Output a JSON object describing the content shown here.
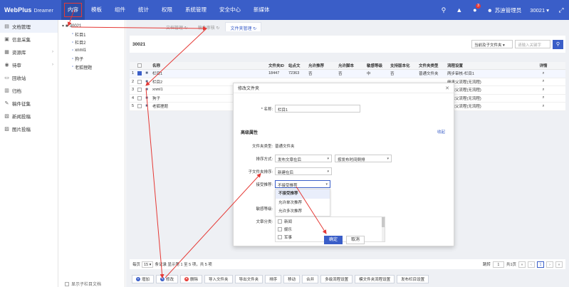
{
  "app": {
    "brand": "WebPlus",
    "sub": "Dreamer"
  },
  "nav": [
    "内容",
    "模板",
    "组件",
    "统计",
    "权限",
    "系统管理",
    "安全中心",
    "新媒体"
  ],
  "topbar": {
    "badge": "3",
    "user": "苏迪管理员",
    "site": "30021",
    "colors": {
      "bar": "#3a5ec8",
      "annotation": "#e53935"
    }
  },
  "sidebar": [
    {
      "label": "文档管理",
      "icon": "doc-icon"
    },
    {
      "label": "信息采集",
      "icon": "collect-icon"
    },
    {
      "label": "资源库",
      "icon": "library-icon",
      "arrow": true
    },
    {
      "label": "待审",
      "icon": "audit-icon",
      "arrow": true
    },
    {
      "label": "回收站",
      "icon": "trash-icon"
    },
    {
      "label": "归档",
      "icon": "archive-icon"
    },
    {
      "label": "稿件征集",
      "icon": "draft-icon"
    },
    {
      "label": "新闻投稿",
      "icon": "news-icon"
    },
    {
      "label": "图片投稿",
      "icon": "image-icon"
    }
  ],
  "tree": {
    "root": "30021",
    "children": [
      "栏目1",
      "栏目2",
      "xnml1",
      "狗子",
      "老狐狸题"
    ],
    "bottom": "显示子栏目文档"
  },
  "tabs": [
    "文档管理",
    "稿件审核",
    "文件夹管理"
  ],
  "toolbar": {
    "site_id": "30021",
    "filter": "当前及子文件夹",
    "search_placeholder": "请输入关键字"
  },
  "table": {
    "headers": [
      "",
      "",
      "",
      "名称",
      "文件夹ID",
      "站点文",
      "允许推荐",
      "允许脚本",
      "敏感等级",
      "支持版本化",
      "文件夹类型",
      "流程设置",
      "详情"
    ],
    "rows": [
      {
        "idx": "1",
        "checked": true,
        "name": "栏目1",
        "id": "18447",
        "site": "72363",
        "rec": "否",
        "script": "否",
        "sens": "中",
        "std": "否",
        "type": "普通文件夹",
        "flow": "两步审核-栏目1"
      },
      {
        "idx": "2",
        "checked": false,
        "name": "栏目2",
        "id": "",
        "site": "",
        "rec": "",
        "script": "",
        "sens": "",
        "std": "",
        "type": "",
        "flow": "继承父流程(无流程)"
      },
      {
        "idx": "3",
        "checked": false,
        "name": "xnml1",
        "id": "",
        "site": "",
        "rec": "",
        "script": "",
        "sens": "",
        "std": "",
        "type": "",
        "flow": "继承父流程(无流程)"
      },
      {
        "idx": "4",
        "checked": false,
        "name": "狗子",
        "id": "",
        "site": "",
        "rec": "",
        "script": "",
        "sens": "",
        "std": "",
        "type": "",
        "flow": "继承父流程(无流程)"
      },
      {
        "idx": "5",
        "checked": false,
        "name": "老狐狸题",
        "id": "",
        "site": "",
        "rec": "",
        "script": "",
        "sens": "",
        "std": "",
        "type": "",
        "flow": "继承父流程(无流程)"
      }
    ]
  },
  "pager": {
    "prefix": "每页",
    "size": "15",
    "summary": "条记录 显示第 1 至 5 项，共 5 项",
    "jump_label": "跳转",
    "jump_value": "1",
    "total_pages": "共1页",
    "current": "1"
  },
  "actions": [
    "增加",
    "修改",
    "删除",
    "导入文件夹",
    "导出文件夹",
    "排序",
    "移动",
    "合并",
    "多级流程设置",
    "模文件夹流程设置",
    "发布栏目设置"
  ],
  "modal": {
    "title": "修改文件夹",
    "name_label": "* 名称:",
    "name_value": "栏目1",
    "section": "高级属性",
    "collapse": "收起",
    "type_label": "文件夹类型:",
    "type_value": "普通文件夹",
    "sort_label": "排序方式:",
    "sort_value": "发布文章在后",
    "sort_value2": "按发布时间倒排",
    "sub_sort_label": "子文件夹排序:",
    "sub_sort_value": "新建在后",
    "recommend_label": "接受推荐:",
    "recommend_value": "不接受推荐",
    "dropdown": [
      "不接受推荐",
      "允许单次推荐",
      "允许多次推荐"
    ],
    "sens_label": "敏感等级:",
    "cat_label": "文章分类:",
    "categories": [
      "新闻",
      "娱乐",
      "军事"
    ],
    "ok": "确定",
    "cancel": "取消"
  }
}
